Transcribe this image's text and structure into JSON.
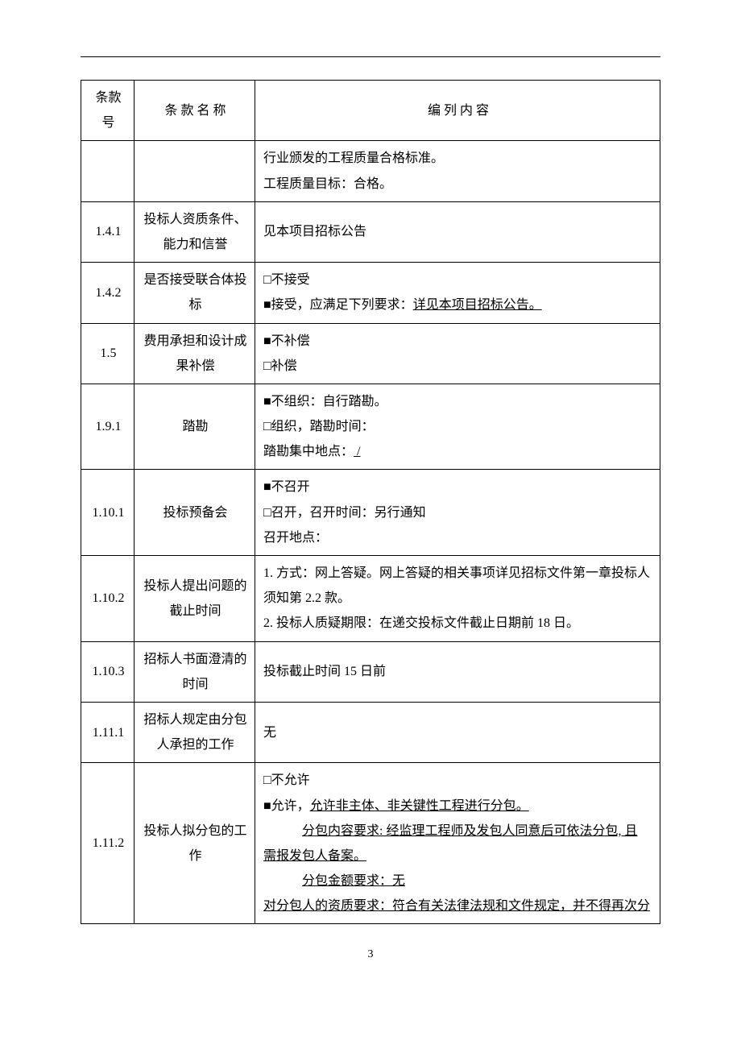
{
  "header": {
    "col_no": "条款号",
    "col_name": "条 款 名 称",
    "col_content": "编  列  内  容"
  },
  "rows": [
    {
      "no": "",
      "name": "",
      "content_html": "行业颁发的工程质量合格标准。<br>工程质量目标：合格。"
    },
    {
      "no": "1.4.1",
      "name": "投标人资质条件、能力和信誉",
      "content_html": "见本项目招标公告"
    },
    {
      "no": "1.4.2",
      "name": "是否接受联合体投标",
      "content_html": "<span class=\"sq\">□</span>不接受<br><span class=\"sq\">■</span>接受，应满足下列要求：<span class=\"underline\">详见本项目招标公告。</span>"
    },
    {
      "no": "1.5",
      "name": "费用承担和设计成果补偿",
      "content_html": "<span class=\"sq\">■</span>不补偿<br><span class=\"sq\">□</span>补偿"
    },
    {
      "no": "1.9.1",
      "name": "踏勘",
      "content_html": "<span class=\"sq\">■</span>不组织：自行踏勘。<br><span class=\"sq\">□</span>组织，踏勘时间：<br>踏勘集中地点：<span class=\"u-slash\"> / </span>"
    },
    {
      "no": "1.10.1",
      "name": "投标预备会",
      "content_html": "<span class=\"sq\">■</span>不召开<br><span class=\"sq\">□</span>召开，召开时间：另行通知<br>召开地点："
    },
    {
      "no": "1.10.2",
      "name": "投标人提出问题的截止时间",
      "content_html": "1. 方式：网上答疑。网上答疑的相关事项详见招标文件第一章投标人须知第 2.2 款。<br>2. 投标人质疑期限：在递交投标文件截止日期前 18 日。"
    },
    {
      "no": "1.10.3",
      "name": "招标人书面澄清的时间",
      "content_html": "投标截止时间 15 日前"
    },
    {
      "no": "1.11.1",
      "name": "招标人规定由分包人承担的工作",
      "content_html": "无"
    },
    {
      "no": "1.11.2",
      "name": "投标人拟分包的工作",
      "content_html": "<span class=\"sq\">□</span>不允许<br><span class=\"sq\">■</span>允许，<span class=\"underline\">允许非主体、非关键性工程进行分包。</span><br><span class=\"indent underline\">分包内容要求: 经监理工程师及发包人同意后可依法分包, 且</span><br><span class=\"underline\">需报发包人备案。</span><br><span class=\"indent underline\">分包金额要求：无</span><br><span class=\"underline\">对分包人的资质要求：符合有关法律法规和文件规定，并不得再次分</span>"
    }
  ],
  "page_number": "3"
}
